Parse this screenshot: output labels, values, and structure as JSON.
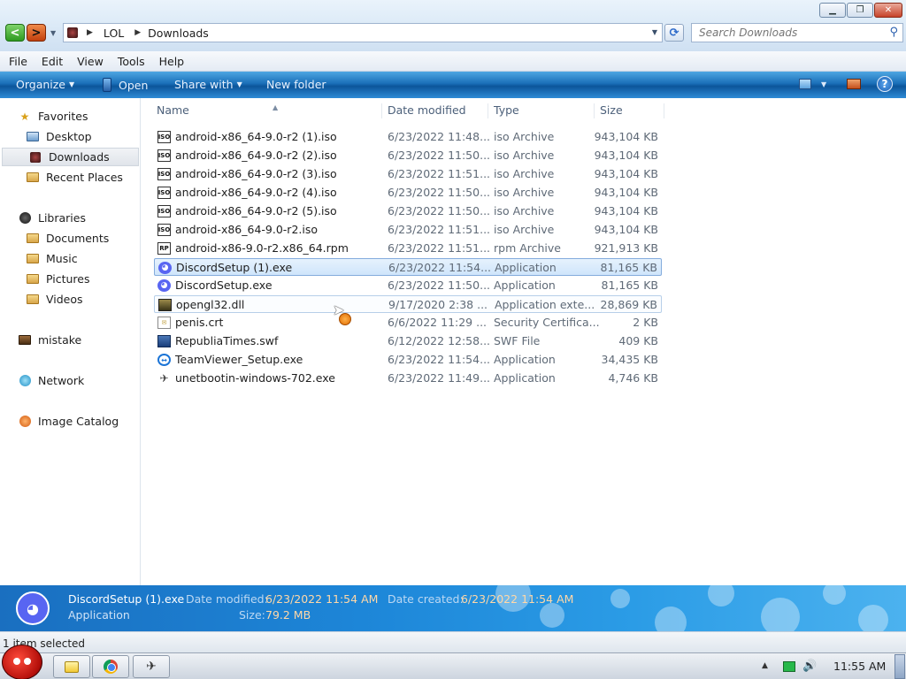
{
  "window": {
    "minimize_icon": "minimize-icon",
    "maximize_icon": "maximize-icon",
    "close_icon": "close-icon"
  },
  "nav": {
    "back_glyph": "<",
    "forward_glyph": ">",
    "breadcrumbs": [
      "LOL",
      "Downloads"
    ],
    "refresh_glyph": "⟳",
    "search_placeholder": "Search Downloads"
  },
  "menu": {
    "items": [
      "File",
      "Edit",
      "View",
      "Tools",
      "Help"
    ]
  },
  "toolbar": {
    "organize": "Organize",
    "open": "Open",
    "share": "Share with",
    "new_folder": "New folder",
    "help_glyph": "?"
  },
  "sidebar": {
    "favorites": "Favorites",
    "desktop": "Desktop",
    "downloads": "Downloads",
    "recent": "Recent Places",
    "libraries": "Libraries",
    "documents": "Documents",
    "music": "Music",
    "pictures": "Pictures",
    "videos": "Videos",
    "mistake": "mistake",
    "network": "Network",
    "image_catalog": "Image Catalog"
  },
  "columns": {
    "name": "Name",
    "date": "Date modified",
    "type": "Type",
    "size": "Size"
  },
  "files": [
    {
      "name": "android-x86_64-9.0-r2 (1).iso",
      "date": "6/23/2022 11:48...",
      "type": "iso Archive",
      "size": "943,104 KB",
      "icon": "iso-file-icon",
      "glyph": "ISO"
    },
    {
      "name": "android-x86_64-9.0-r2 (2).iso",
      "date": "6/23/2022 11:50...",
      "type": "iso Archive",
      "size": "943,104 KB",
      "icon": "iso-file-icon",
      "glyph": "ISO"
    },
    {
      "name": "android-x86_64-9.0-r2 (3).iso",
      "date": "6/23/2022 11:51...",
      "type": "iso Archive",
      "size": "943,104 KB",
      "icon": "iso-file-icon",
      "glyph": "ISO"
    },
    {
      "name": "android-x86_64-9.0-r2 (4).iso",
      "date": "6/23/2022 11:50...",
      "type": "iso Archive",
      "size": "943,104 KB",
      "icon": "iso-file-icon",
      "glyph": "ISO"
    },
    {
      "name": "android-x86_64-9.0-r2 (5).iso",
      "date": "6/23/2022 11:50...",
      "type": "iso Archive",
      "size": "943,104 KB",
      "icon": "iso-file-icon",
      "glyph": "ISO"
    },
    {
      "name": "android-x86_64-9.0-r2.iso",
      "date": "6/23/2022 11:51...",
      "type": "iso Archive",
      "size": "943,104 KB",
      "icon": "iso-file-icon",
      "glyph": "ISO"
    },
    {
      "name": "android-x86-9.0-r2.x86_64.rpm",
      "date": "6/23/2022 11:51...",
      "type": "rpm Archive",
      "size": "921,913 KB",
      "icon": "rpm-file-icon",
      "glyph": "RP"
    },
    {
      "name": "DiscordSetup (1).exe",
      "date": "6/23/2022 11:54...",
      "type": "Application",
      "size": "81,165 KB",
      "icon": "discord-icon",
      "glyph": "◕"
    },
    {
      "name": "DiscordSetup.exe",
      "date": "6/23/2022 11:50...",
      "type": "Application",
      "size": "81,165 KB",
      "icon": "discord-icon",
      "glyph": "◕"
    },
    {
      "name": "opengl32.dll",
      "date": "9/17/2020 2:38 ...",
      "type": "Application exte...",
      "size": "28,869 KB",
      "icon": "dll-file-icon",
      "glyph": ""
    },
    {
      "name": "penis.crt",
      "date": "6/6/2022 11:29 ...",
      "type": "Security Certifica...",
      "size": "2 KB",
      "icon": "certificate-icon",
      "glyph": "✉"
    },
    {
      "name": "RepubliaTimes.swf",
      "date": "6/12/2022 12:58...",
      "type": "SWF File",
      "size": "409 KB",
      "icon": "swf-file-icon",
      "glyph": ""
    },
    {
      "name": "TeamViewer_Setup.exe",
      "date": "6/23/2022 11:54...",
      "type": "Application",
      "size": "34,435 KB",
      "icon": "teamviewer-icon",
      "glyph": "↔"
    },
    {
      "name": "unetbootin-windows-702.exe",
      "date": "6/23/2022 11:49...",
      "type": "Application",
      "size": "4,746 KB",
      "icon": "unetbootin-icon",
      "glyph": "✈"
    }
  ],
  "details": {
    "name": "DiscordSetup (1).exe",
    "type": "Application",
    "modified_label": "Date modified:",
    "modified_value": "6/23/2022 11:54 AM",
    "created_label": "Date created:",
    "created_value": "6/23/2022 11:54 AM",
    "size_label": "Size:",
    "size_value": "79.2 MB"
  },
  "status": {
    "text": "1 item selected"
  },
  "taskbar": {
    "clock": "11:55 AM",
    "volume_glyph": "🔊",
    "unet_glyph": "✈"
  }
}
